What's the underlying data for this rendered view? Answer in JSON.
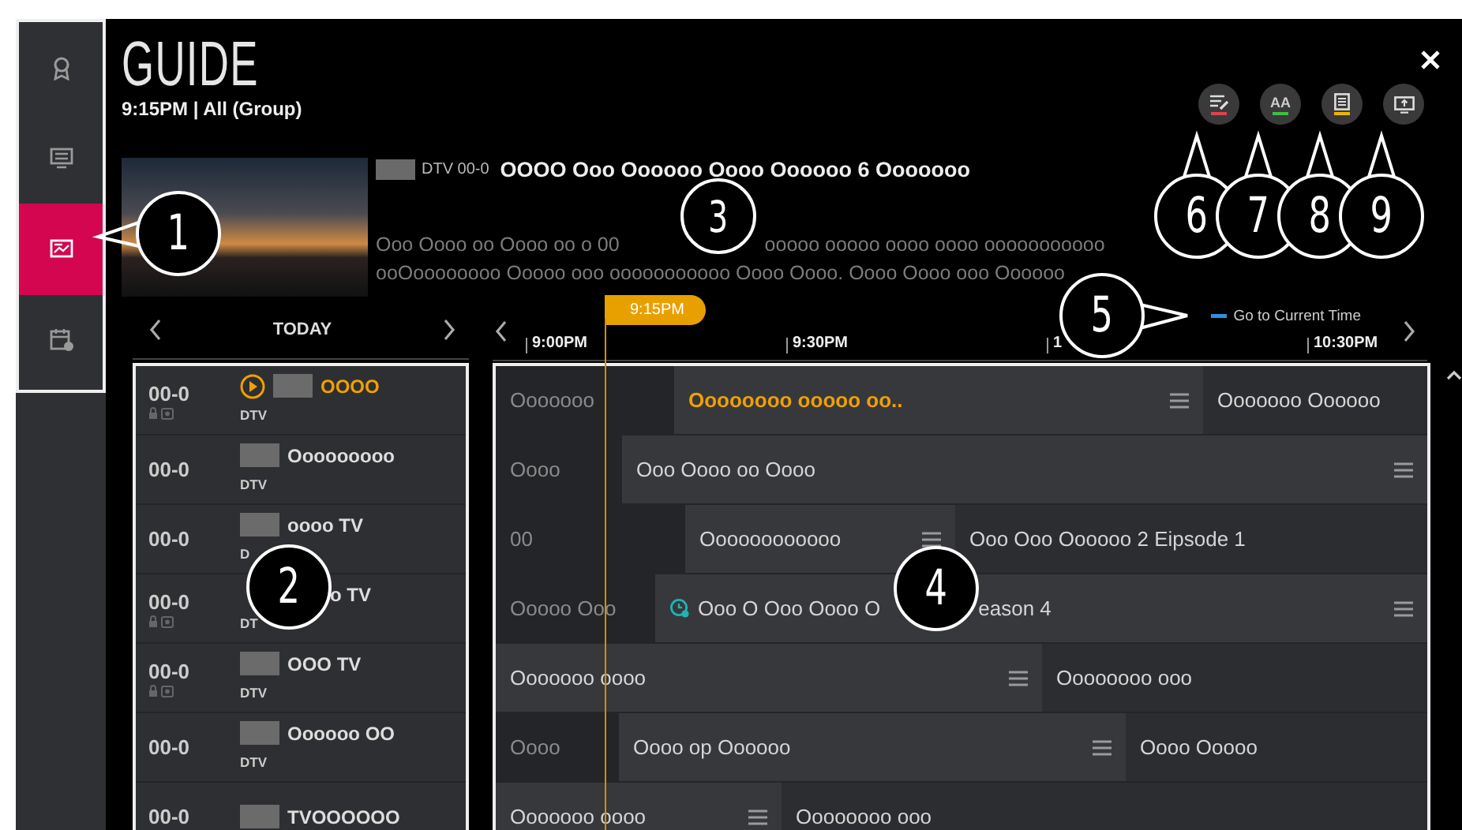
{
  "sidebar": {
    "items": [
      {
        "kind": "ribbon",
        "selected": false
      },
      {
        "kind": "screen",
        "selected": false
      },
      {
        "kind": "guide",
        "selected": true
      },
      {
        "kind": "schedule",
        "selected": false
      }
    ]
  },
  "header": {
    "title": "GUIDE",
    "subtitle": "9:15PM | All (Group)"
  },
  "actions": [
    {
      "kind": "edit",
      "color": "#e0424f"
    },
    {
      "kind": "text-size",
      "label": "AA",
      "color": "#3cc13c"
    },
    {
      "kind": "list",
      "color": "#f0b400"
    },
    {
      "kind": "screen"
    }
  ],
  "preview": {
    "channel": "DTV 00-0",
    "title": "OOOO Ooo Oooooo Oooo Oooooo 6 Ooooooo",
    "description": [
      [
        "Ooo Oooo oo Oooo oo o 00",
        "ooooo ooooo oooo oooo ooooooooooo"
      ],
      [
        "ooOoooooooo Ooooo ooo ooooooooooo Oooo Oooo. Oooo Oooo ooo Oooooo"
      ]
    ]
  },
  "timeline": {
    "day": "TODAY",
    "now": "9:15PM",
    "go_to": "Go to Current Time",
    "ticks": [
      "9:00PM",
      "9:30PM",
      "1",
      "10:30PM"
    ]
  },
  "channels": [
    {
      "number": "00-0",
      "name": "OOOO",
      "tag": "DTV",
      "logo": true,
      "locked": true,
      "selected": true,
      "programs": [
        {
          "title": "Ooooooo",
          "kind": "past",
          "selected": false
        },
        {
          "title": "Oooooooo ooooo oo..",
          "kind": "now",
          "selected": true
        },
        {
          "title": "Ooooooo Oooooo",
          "kind": "next",
          "selected": false
        }
      ]
    },
    {
      "number": "00-0",
      "name": "Ooooooooo",
      "tag": "DTV",
      "logo": true,
      "locked": false,
      "selected": false,
      "programs": [
        {
          "title": "Oooo",
          "kind": "past",
          "selected": false
        },
        {
          "title": "Ooo Oooo oo Oooo",
          "kind": "now",
          "selected": false
        }
      ]
    },
    {
      "number": "00-0",
      "name": "oooo TV",
      "tag": "D",
      "logo": true,
      "locked": false,
      "selected": false,
      "programs": [
        {
          "title": "00",
          "kind": "past",
          "selected": false
        },
        {
          "title": "Oooooooooooo",
          "kind": "now",
          "selected": false
        },
        {
          "title": "Ooo Ooo Oooooo 2 Eipsode 1",
          "kind": "next",
          "selected": false
        }
      ]
    },
    {
      "number": "00-0",
      "name": "o TV",
      "tag": "DT",
      "logo": false,
      "locked": true,
      "selected": false,
      "programs": [
        {
          "title": "Ooooo Ooo",
          "kind": "past",
          "selected": false
        },
        {
          "title": "Ooo O Ooo Oooo O",
          "continued": "eason 4",
          "kind": "now",
          "selected": false,
          "reminder": true
        }
      ]
    },
    {
      "number": "00-0",
      "name": "OOO TV",
      "tag": "DTV",
      "logo": true,
      "locked": true,
      "selected": false,
      "programs": [
        {
          "title": "Ooooooo oooo",
          "kind": "now",
          "selected": false
        },
        {
          "title": "Oooooooo ooo",
          "kind": "next",
          "selected": false
        }
      ]
    },
    {
      "number": "00-0",
      "name": "Oooooo OO",
      "tag": "DTV",
      "logo": true,
      "locked": false,
      "selected": false,
      "programs": [
        {
          "title": "Oooo",
          "kind": "past",
          "selected": false
        },
        {
          "title": "Oooo op Oooooo",
          "kind": "now",
          "selected": false
        },
        {
          "title": "Oooo Ooooo",
          "kind": "next",
          "selected": false
        }
      ]
    },
    {
      "number": "00-0",
      "name": "TVOOOOOO",
      "logo": true,
      "locked": false,
      "selected": false,
      "programs": [
        {
          "title": "Ooooooo oooo",
          "kind": "now",
          "selected": false
        },
        {
          "title": "Oooooooo ooo",
          "kind": "next",
          "selected": false
        }
      ]
    }
  ],
  "callouts": [
    "1",
    "2",
    "3",
    "4",
    "5",
    "6",
    "7",
    "8",
    "9"
  ]
}
